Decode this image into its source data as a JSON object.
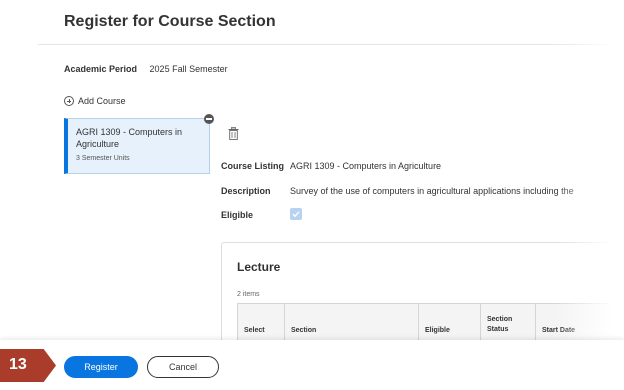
{
  "page": {
    "title": "Register for Course Section"
  },
  "academic_period": {
    "label": "Academic Period",
    "value": "2025 Fall Semester"
  },
  "add_course": {
    "label": "Add Course",
    "icon": "plus-circle-icon"
  },
  "course_card": {
    "name": "AGRI 1309 - Computers in Agriculture",
    "units": "3 Semester Units"
  },
  "details": {
    "course_listing_label": "Course Listing",
    "course_listing_value": "AGRI 1309 - Computers in Agriculture",
    "description_label": "Description",
    "description_value": "Survey of the use of computers in agricultural applications including the",
    "eligible_label": "Eligible",
    "eligible_checked": true
  },
  "lecture": {
    "title": "Lecture",
    "item_count": "2 items",
    "columns": [
      "Select",
      "Section",
      "Eligible",
      "Section Status",
      "Start Date"
    ]
  },
  "footer": {
    "step_number": "13",
    "register_label": "Register",
    "cancel_label": "Cancel"
  },
  "colors": {
    "accent": "#0875e1",
    "step_badge": "#a93c2b",
    "card_bg": "#e6f1fb"
  }
}
